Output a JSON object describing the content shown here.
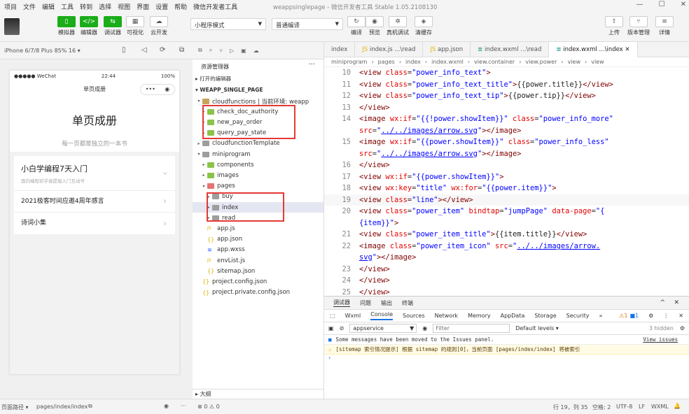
{
  "menu": [
    "项目",
    "文件",
    "编辑",
    "工具",
    "转到",
    "选择",
    "视图",
    "界面",
    "设置",
    "帮助",
    "微信开发者工具"
  ],
  "window_title": "weappsinglepage - 微信开发者工具 Stable 1.05.2108130",
  "window_controls": [
    "—",
    "☐",
    "✕"
  ],
  "toolbar": {
    "simulator": "模拟器",
    "editor": "编辑器",
    "debugger": "调试器",
    "visual": "可视化",
    "cloud": "云开发",
    "mode_select": "小程序模式",
    "compile_select": "普通编译",
    "compile": "编译",
    "preview": "预览",
    "remote_debug": "真机调试",
    "clear_cache": "清缓存",
    "upload": "上传",
    "version": "版本管理",
    "details": "详情"
  },
  "simulator": {
    "device": "iPhone 6/7/8 Plus 85% 16 ▾",
    "status_left": "●●●●● WeChat",
    "status_time": "22:44",
    "status_right": "100%",
    "nav_title": "单页成册",
    "header_title": "单页成册",
    "header_sub": "每一页都是独立的一本书",
    "card_title": "小白学编程7天入门",
    "card_sub": "面向编程初学者提倡入门互动号",
    "item2": "2021极客时间应邀4周年感言",
    "item3": "诗词小集"
  },
  "explorer": {
    "title": "资源管理器",
    "open_editors": "打开的编辑器",
    "project": "WEAPP_SINGLE_PAGE",
    "tree": [
      {
        "label": "cloudfunctions | 当前环境: weapp",
        "indent": 1,
        "kind": "folder",
        "open": true
      },
      {
        "label": "check_doc_authority",
        "indent": 2,
        "kind": "folder-green",
        "open": false
      },
      {
        "label": "new_pay_order",
        "indent": 2,
        "kind": "folder-green",
        "open": false
      },
      {
        "label": "query_pay_state",
        "indent": 2,
        "kind": "folder-green",
        "open": false
      },
      {
        "label": "cloudfunctionTemplate",
        "indent": 1,
        "kind": "folder-gray",
        "open": false
      },
      {
        "label": "miniprogram",
        "indent": 1,
        "kind": "folder-gray",
        "open": true
      },
      {
        "label": "components",
        "indent": 2,
        "kind": "folder-green",
        "open": false
      },
      {
        "label": "images",
        "indent": 2,
        "kind": "folder-green",
        "open": false
      },
      {
        "label": "pages",
        "indent": 2,
        "kind": "folder-red",
        "open": true
      },
      {
        "label": "buy",
        "indent": 3,
        "kind": "folder-gray",
        "open": false
      },
      {
        "label": "index",
        "indent": 3,
        "kind": "folder-gray",
        "open": false,
        "selected": true
      },
      {
        "label": "read",
        "indent": 3,
        "kind": "folder-gray",
        "open": false
      },
      {
        "label": "app.js",
        "indent": 2,
        "kind": "js"
      },
      {
        "label": "app.json",
        "indent": 2,
        "kind": "json"
      },
      {
        "label": "app.wxss",
        "indent": 2,
        "kind": "wxss"
      },
      {
        "label": "envList.js",
        "indent": 2,
        "kind": "js"
      },
      {
        "label": "sitemap.json",
        "indent": 2,
        "kind": "json"
      },
      {
        "label": "project.config.json",
        "indent": 1,
        "kind": "json"
      },
      {
        "label": "project.private.config.json",
        "indent": 1,
        "kind": "json"
      }
    ],
    "outline": "大纲",
    "errors": "⊗ 0 ⚠ 0"
  },
  "tabs": [
    "index",
    "index.js ...\\read",
    "app.json",
    "index.wxml ...\\read",
    "index.wxml ...\\index"
  ],
  "breadcrumb": [
    "miniprogram",
    "pages",
    "index",
    "index.wxml",
    "view.container",
    "view.power",
    "view",
    "view"
  ],
  "code": [
    {
      "n": "10",
      "html": "  <span class=\"t\">&lt;view</span> <span class=\"a\">class</span>=<span class=\"s\">\"power_info_text\"</span><span class=\"t\">&gt;</span>"
    },
    {
      "n": "11",
      "html": "    <span class=\"t\">&lt;view</span> <span class=\"a\">class</span>=<span class=\"s\">\"power_info_text_title\"</span><span class=\"t\">&gt;</span><span class=\"p\">{{power.title}}</span><span class=\"t\">&lt;/view&gt;</span>"
    },
    {
      "n": "12",
      "html": "    <span class=\"t\">&lt;view</span> <span class=\"a\">class</span>=<span class=\"s\">\"power_info_text_tip\"</span><span class=\"t\">&gt;</span><span class=\"p\">{{power.tip}}</span><span class=\"t\">&lt;/view&gt;</span>"
    },
    {
      "n": "13",
      "html": "  <span class=\"t\">&lt;/view&gt;</span>"
    },
    {
      "n": "14",
      "html": "  <span class=\"t\">&lt;image</span> <span class=\"a\">wx:if</span>=<span class=\"s\">\"{{!power.showItem}}\"</span> <span class=\"a\">class</span>=<span class=\"s\">\"power_info_more\"</span>"
    },
    {
      "n": "",
      "html": "  <span class=\"a\">src</span>=<span class=\"s\">\"<u>../../images/arrow.svg</u>\"</span><span class=\"t\">&gt;&lt;/image&gt;</span>"
    },
    {
      "n": "15",
      "html": "  <span class=\"t\">&lt;image</span> <span class=\"a\">wx:if</span>=<span class=\"s\">\"{{power.showItem}}\"</span> <span class=\"a\">class</span>=<span class=\"s\">\"power_info_less\"</span>"
    },
    {
      "n": "",
      "html": "  <span class=\"a\">src</span>=<span class=\"s\">\"<u>../../images/arrow.svg</u>\"</span><span class=\"t\">&gt;&lt;/image&gt;</span>"
    },
    {
      "n": "16",
      "html": "<span class=\"t\">&lt;/view&gt;</span>"
    },
    {
      "n": "17",
      "html": "<span class=\"t\">&lt;view</span> <span class=\"a\">wx:if</span>=<span class=\"s\">\"{{power.showItem}}\"</span><span class=\"t\">&gt;</span>"
    },
    {
      "n": "18",
      "html": "  <span class=\"t\">&lt;view</span> <span class=\"a\">wx:key</span>=<span class=\"s\">\"title\"</span> <span class=\"a\">wx:for</span>=<span class=\"s\">\"{{power.item}}\"</span><span class=\"t\">&gt;</span>"
    },
    {
      "n": "19",
      "html": "    <span class=\"t\">&lt;view</span> <span class=\"a\">class</span>=<span class=\"s\">\"line\"</span><span class=\"t\">&gt;&lt;/view&gt;</span>"
    },
    {
      "n": "20",
      "html": "    <span class=\"t\">&lt;view</span> <span class=\"a\">class</span>=<span class=\"s\">\"power_item\"</span> <span class=\"a\">bindtap</span>=<span class=\"s\">\"jumpPage\"</span> <span class=\"a\">data-page</span>=<span class=\"s\">\"{</span>"
    },
    {
      "n": "",
      "html": "    <span class=\"s\">{item}}\"</span><span class=\"t\">&gt;</span>"
    },
    {
      "n": "21",
      "html": "      <span class=\"t\">&lt;view</span> <span class=\"a\">class</span>=<span class=\"s\">\"power_item_title\"</span><span class=\"t\">&gt;</span><span class=\"p\">{{item.title}}</span><span class=\"t\">&lt;/view&gt;</span>"
    },
    {
      "n": "22",
      "html": "      <span class=\"t\">&lt;image</span> <span class=\"a\">class</span>=<span class=\"s\">\"power_item_icon\"</span> <span class=\"a\">src</span>=<span class=\"s\">\"<u>../../images/arrow.</u></span>"
    },
    {
      "n": "",
      "html": "      <span class=\"s\"><u>svg</u>\"</span><span class=\"t\">&gt;&lt;/image&gt;</span>"
    },
    {
      "n": "23",
      "html": "    <span class=\"t\">&lt;/view&gt;</span>"
    },
    {
      "n": "24",
      "html": "  <span class=\"t\">&lt;/view&gt;</span>"
    },
    {
      "n": "25",
      "html": "<span class=\"t\">&lt;/view&gt;</span>"
    }
  ],
  "devtools": {
    "top_tabs": [
      "调试器",
      "问题",
      "输出",
      "终端"
    ],
    "tabs": [
      "Wxml",
      "Console",
      "Sources",
      "Network",
      "Memory",
      "AppData",
      "Storage",
      "Security",
      "»"
    ],
    "active_tab": "Console",
    "context": "appservice",
    "filter_placeholder": "Filter",
    "levels": "Default levels ▾",
    "hidden": "3 hidden",
    "warn_count": "1",
    "info_count": "1",
    "msg1": "Some messages have been moved to the Issues panel.",
    "msg1_link": "View issues",
    "msg2": "[sitemap 索引情况提示] 根据 sitemap 的规则[0]，当前页面 [pages/index/index] 将被索引"
  },
  "statusbar": {
    "page_path_label": "页面路径 ▾",
    "page_path": "pages/index/index",
    "position": "行 19，列 35",
    "spaces": "空格: 2",
    "encoding": "UTF-8",
    "eol": "LF",
    "lang": "WXML"
  }
}
